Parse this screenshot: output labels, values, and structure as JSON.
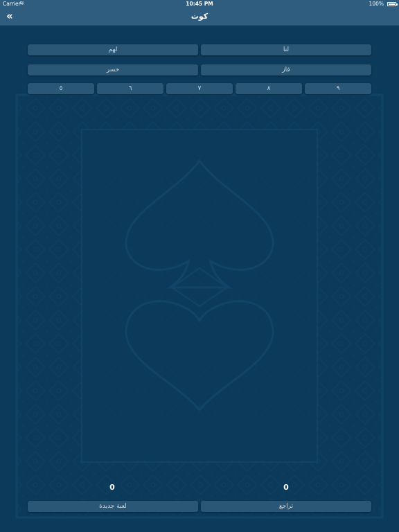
{
  "status_bar": {
    "carrier": "Carrier",
    "time": "10:45 PM",
    "battery": "100%"
  },
  "nav": {
    "back_icon": "double-chevron-left-icon",
    "title": "كوت"
  },
  "teams": {
    "us": "لنا",
    "them": "لهم"
  },
  "results": {
    "won": "فاز",
    "lost": "خسر"
  },
  "numbers": [
    "٩",
    "٨",
    "٧",
    "٦",
    "٥"
  ],
  "scores": {
    "us": "0",
    "them": "0"
  },
  "actions": {
    "undo": "تراجع",
    "new_game": "لعبة جديدة"
  },
  "colors": {
    "background": "#0c3a5b",
    "bar": "#2e5d7f",
    "button": "#2b5776"
  }
}
